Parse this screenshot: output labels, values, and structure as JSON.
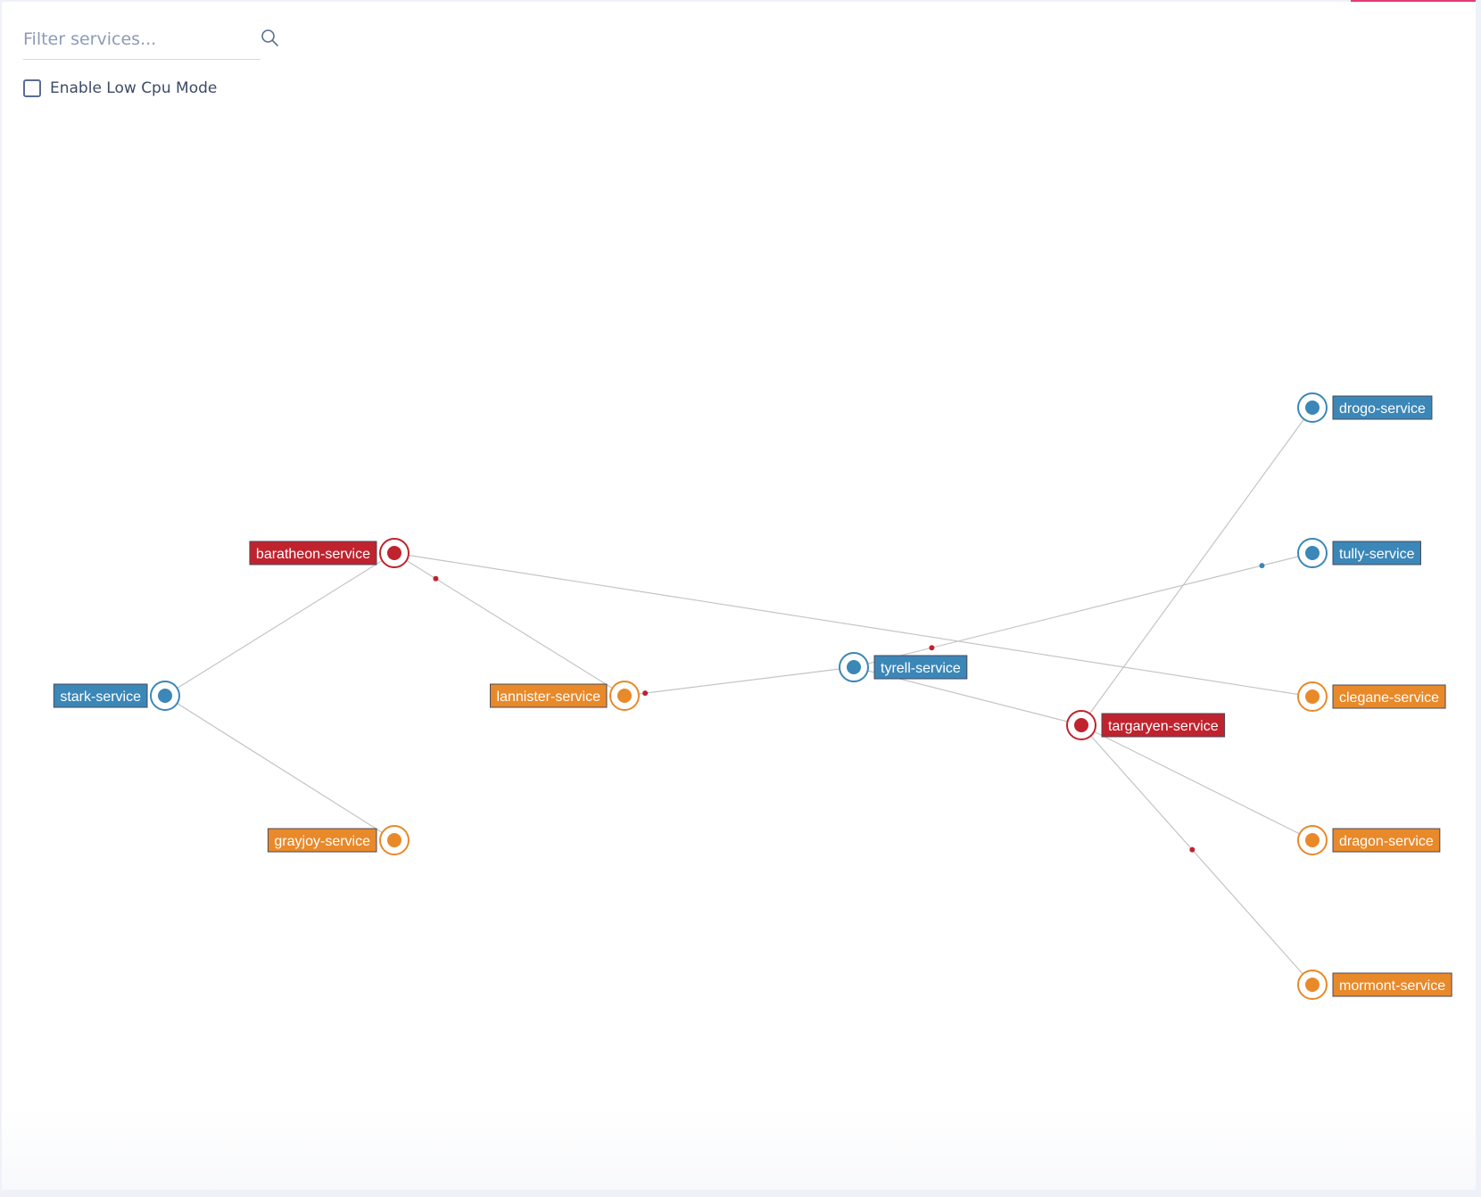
{
  "filter": {
    "placeholder": "Filter services...",
    "value": "",
    "icon": "search-icon"
  },
  "low_cpu_mode": {
    "label": "Enable Low Cpu Mode",
    "checked": false
  },
  "colors": {
    "healthy": "#3b87b8",
    "warning": "#e8892a",
    "error": "#c0232e",
    "edge": "#c4c4c4",
    "label_border": "#4a4a5a",
    "accent": "#e63a74"
  },
  "graph": {
    "nodes": [
      {
        "id": "stark",
        "label": "stark-service",
        "status": "healthy",
        "label_side": "left"
      },
      {
        "id": "baratheon",
        "label": "baratheon-service",
        "status": "error",
        "label_side": "left"
      },
      {
        "id": "grayjoy",
        "label": "grayjoy-service",
        "status": "warning",
        "label_side": "left"
      },
      {
        "id": "lannister",
        "label": "lannister-service",
        "status": "warning",
        "label_side": "left"
      },
      {
        "id": "tyrell",
        "label": "tyrell-service",
        "status": "healthy",
        "label_side": "right"
      },
      {
        "id": "targaryen",
        "label": "targaryen-service",
        "status": "error",
        "label_side": "right"
      },
      {
        "id": "drogo",
        "label": "drogo-service",
        "status": "healthy",
        "label_side": "right"
      },
      {
        "id": "tully",
        "label": "tully-service",
        "status": "healthy",
        "label_side": "right"
      },
      {
        "id": "clegane",
        "label": "clegane-service",
        "status": "warning",
        "label_side": "right"
      },
      {
        "id": "dragon",
        "label": "dragon-service",
        "status": "warning",
        "label_side": "right"
      },
      {
        "id": "mormont",
        "label": "mormont-service",
        "status": "warning",
        "label_side": "right"
      }
    ],
    "edges": [
      {
        "source": "stark",
        "target": "baratheon",
        "traffic": []
      },
      {
        "source": "stark",
        "target": "grayjoy",
        "traffic": []
      },
      {
        "source": "baratheon",
        "target": "lannister",
        "traffic": [
          {
            "status": "error",
            "t": 0.18
          }
        ]
      },
      {
        "source": "baratheon",
        "target": "clegane",
        "traffic": []
      },
      {
        "source": "lannister",
        "target": "tyrell",
        "traffic": [
          {
            "status": "error",
            "t": 0.09
          }
        ]
      },
      {
        "source": "tyrell",
        "target": "tully",
        "traffic": [
          {
            "status": "error",
            "t": 0.17
          },
          {
            "status": "healthy",
            "t": 0.89
          }
        ]
      },
      {
        "source": "tyrell",
        "target": "targaryen",
        "traffic": []
      },
      {
        "source": "targaryen",
        "target": "drogo",
        "traffic": []
      },
      {
        "source": "targaryen",
        "target": "dragon",
        "traffic": []
      },
      {
        "source": "targaryen",
        "target": "mormont",
        "traffic": [
          {
            "status": "error",
            "t": 0.48
          }
        ]
      }
    ]
  }
}
